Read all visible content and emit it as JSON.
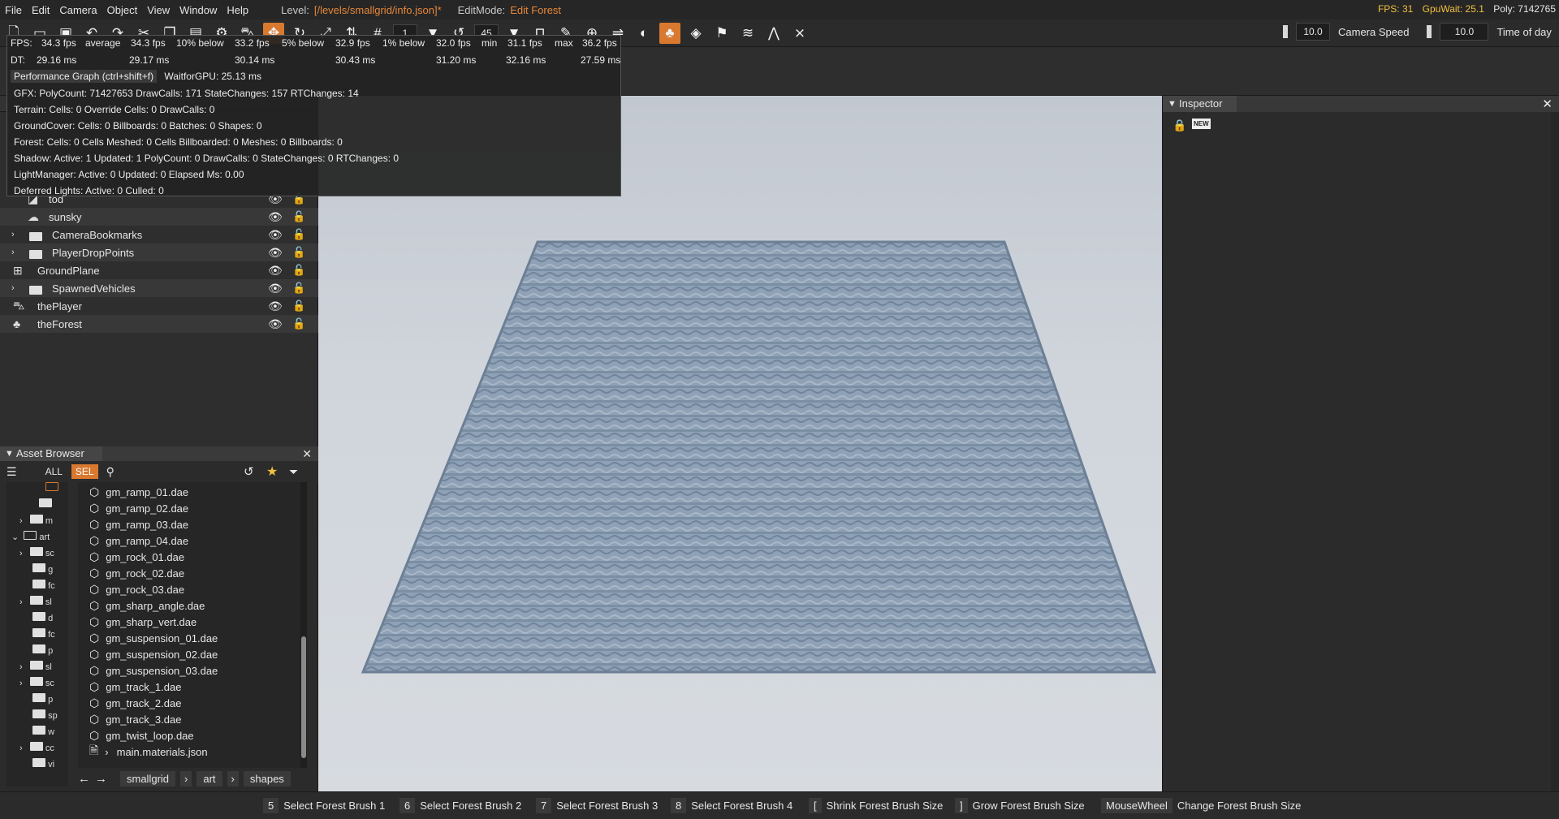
{
  "menubar": {
    "items": [
      "File",
      "Edit",
      "Camera",
      "Object",
      "View",
      "Window",
      "Help"
    ],
    "level_label": "Level:",
    "level_value": "[/levels/smallgrid/info.json]*",
    "editmode_label": "EditMode:",
    "editmode_value": "Edit Forest",
    "fps": "FPS: 31",
    "gpuwait": "GpuWait: 25.1",
    "poly": "Poly: 7142765"
  },
  "toolbar": {
    "icons": [
      "new-file-icon",
      "open-folder-icon",
      "save-icon",
      "undo-icon",
      "redo-icon",
      "cut-icon",
      "copy-icon",
      "paste-icon",
      "gear-icon",
      "car-icon",
      "select-tool-icon",
      "rotate-tool-icon",
      "scale-tool-icon",
      "snap-icon",
      "grid-icon"
    ],
    "grid_value": "1",
    "angle_value": "45",
    "camera_speed_value": "10.0",
    "camera_speed_label": "Camera Speed",
    "time_of_day_value": "10.0",
    "time_of_day_label": "Time of day"
  },
  "perf": {
    "fps_row": [
      {
        "label": "FPS:",
        "value": "34.3 fps"
      },
      {
        "label": "average",
        "value": "34.3 fps"
      },
      {
        "label": "10% below",
        "value": "33.2 fps"
      },
      {
        "label": "5% below",
        "value": "32.9 fps"
      },
      {
        "label": "1% below",
        "value": "32.0 fps"
      },
      {
        "label": "min",
        "value": "31.1 fps"
      },
      {
        "label": "max",
        "value": "36.2 fps"
      }
    ],
    "dt_label": "DT:",
    "dt_values": [
      "29.16 ms",
      "29.17 ms",
      "30.14 ms",
      "30.43 ms",
      "31.20 ms",
      "32.16 ms",
      "27.59 ms"
    ],
    "graph_label": "Performance Graph (ctrl+shift+f)",
    "waitforgpu": "WaitforGPU: 25.13 ms",
    "lines": [
      "GFX:  PolyCount: 71427653  DrawCalls: 171  StateChanges: 157  RTChanges: 14",
      "Terrain:  Cells: 0  Override Cells: 0  DrawCalls: 0",
      "GroundCover:  Cells: 0  Billboards: 0  Batches: 0  Shapes: 0",
      "Forest:  Cells: 0  Cells Meshed: 0  Cells Billboarded: 0  Meshes: 0  Billboards: 0",
      "Shadow:  Active: 1  Updated: 1  PolyCount: 0  DrawCalls: 0  StateChanges: 0  RTChanges: 0",
      "LightManager:  Active: 0  Updated: 0  Elapsed Ms:  0.00",
      "Deferred Lights:  Active: 0  Culled: 0"
    ]
  },
  "scene_tree": [
    {
      "name": "tod",
      "icon": "sun-icon",
      "expandable": false
    },
    {
      "name": "sunsky",
      "icon": "cloud-sun-icon",
      "expandable": false
    },
    {
      "name": "CameraBookmarks",
      "icon": "folder-icon",
      "expandable": true
    },
    {
      "name": "PlayerDropPoints",
      "icon": "folder-icon",
      "expandable": true
    },
    {
      "name": "GroundPlane",
      "icon": "grid-plane-icon",
      "expandable": false
    },
    {
      "name": "SpawnedVehicles",
      "icon": "folder-icon",
      "expandable": true
    },
    {
      "name": "thePlayer",
      "icon": "car-icon",
      "expandable": false
    },
    {
      "name": "theForest",
      "icon": "tree-icon",
      "expandable": false
    }
  ],
  "asset_browser": {
    "title": "Asset Browser",
    "filter_all": "ALL",
    "filter_sel": "SEL",
    "folders": [
      {
        "name": "",
        "expandable": false
      },
      {
        "name": "m",
        "expandable": true
      },
      {
        "name": "art",
        "expandable": true,
        "open": true
      },
      {
        "name": "sc",
        "expandable": true
      },
      {
        "name": "g",
        "expandable": false
      },
      {
        "name": "fc",
        "expandable": false
      },
      {
        "name": "sl",
        "expandable": true
      },
      {
        "name": "d",
        "expandable": false
      },
      {
        "name": "fc",
        "expandable": false
      },
      {
        "name": "p",
        "expandable": false
      },
      {
        "name": "sl",
        "expandable": true
      },
      {
        "name": "sc",
        "expandable": true
      },
      {
        "name": "p",
        "expandable": false
      },
      {
        "name": "sp",
        "expandable": false
      },
      {
        "name": "w",
        "expandable": false
      },
      {
        "name": "cc",
        "expandable": true
      },
      {
        "name": "vi",
        "expandable": false
      }
    ],
    "files": [
      "gm_ramp_01.dae",
      "gm_ramp_02.dae",
      "gm_ramp_03.dae",
      "gm_ramp_04.dae",
      "gm_rock_01.dae",
      "gm_rock_02.dae",
      "gm_rock_03.dae",
      "gm_sharp_angle.dae",
      "gm_sharp_vert.dae",
      "gm_suspension_01.dae",
      "gm_suspension_02.dae",
      "gm_suspension_03.dae",
      "gm_track_1.dae",
      "gm_track_2.dae",
      "gm_track_3.dae",
      "gm_twist_loop.dae"
    ],
    "materials_file": "main.materials.json",
    "breadcrumb": [
      "smallgrid",
      "art",
      "shapes"
    ]
  },
  "inspector": {
    "title": "Inspector",
    "new_label": "NEW"
  },
  "statusbar": [
    {
      "key": "5",
      "label": "Select Forest Brush 1"
    },
    {
      "key": "6",
      "label": "Select Forest Brush 2"
    },
    {
      "key": "7",
      "label": "Select Forest Brush 3"
    },
    {
      "key": "8",
      "label": "Select Forest Brush 4"
    },
    {
      "key": "[",
      "label": "Shrink Forest Brush Size"
    },
    {
      "key": "]",
      "label": "Grow Forest Brush Size"
    },
    {
      "key": "MouseWheel",
      "label": "Change Forest Brush Size"
    }
  ],
  "colors": {
    "accent": "#d9792f",
    "fps_yellow": "#f0c040",
    "forest_mesh": "#7f93aa",
    "sky": "#d0d5dc"
  }
}
